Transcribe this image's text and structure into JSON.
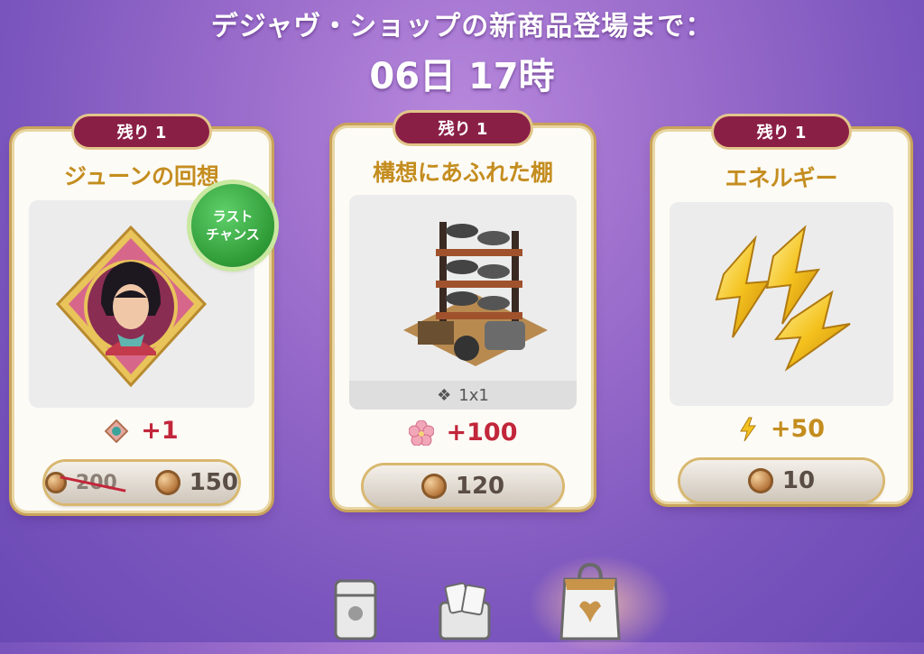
{
  "header": {
    "line1": "デジャヴ・ショップの新商品登場まで：",
    "line2": "06日 17時"
  },
  "cards": [
    {
      "remaining": "残り 1",
      "title": "ジューンの回想",
      "badge": [
        "ラスト",
        "チャンス"
      ],
      "reward": "+1",
      "reward_icon": "memory-gem-icon",
      "price_old": "200",
      "price": "150"
    },
    {
      "remaining": "残り 1",
      "title": "構想にあふれた棚",
      "size_label": "1x1",
      "reward": "+100",
      "reward_icon": "flower-icon",
      "price": "120"
    },
    {
      "remaining": "残り 1",
      "title": "エネルギー",
      "reward": "+50",
      "reward_icon": "lightning-icon",
      "price": "10"
    }
  ],
  "dock": [
    "card-pack-icon",
    "card-box-icon",
    "shop-bag-icon"
  ],
  "colors": {
    "remain_badge": "#8a1f45",
    "title_gold": "#c48d1f",
    "reward_red": "#c2263a",
    "reward_gold": "#c48d1f",
    "badge_green": "#2e9a36"
  }
}
